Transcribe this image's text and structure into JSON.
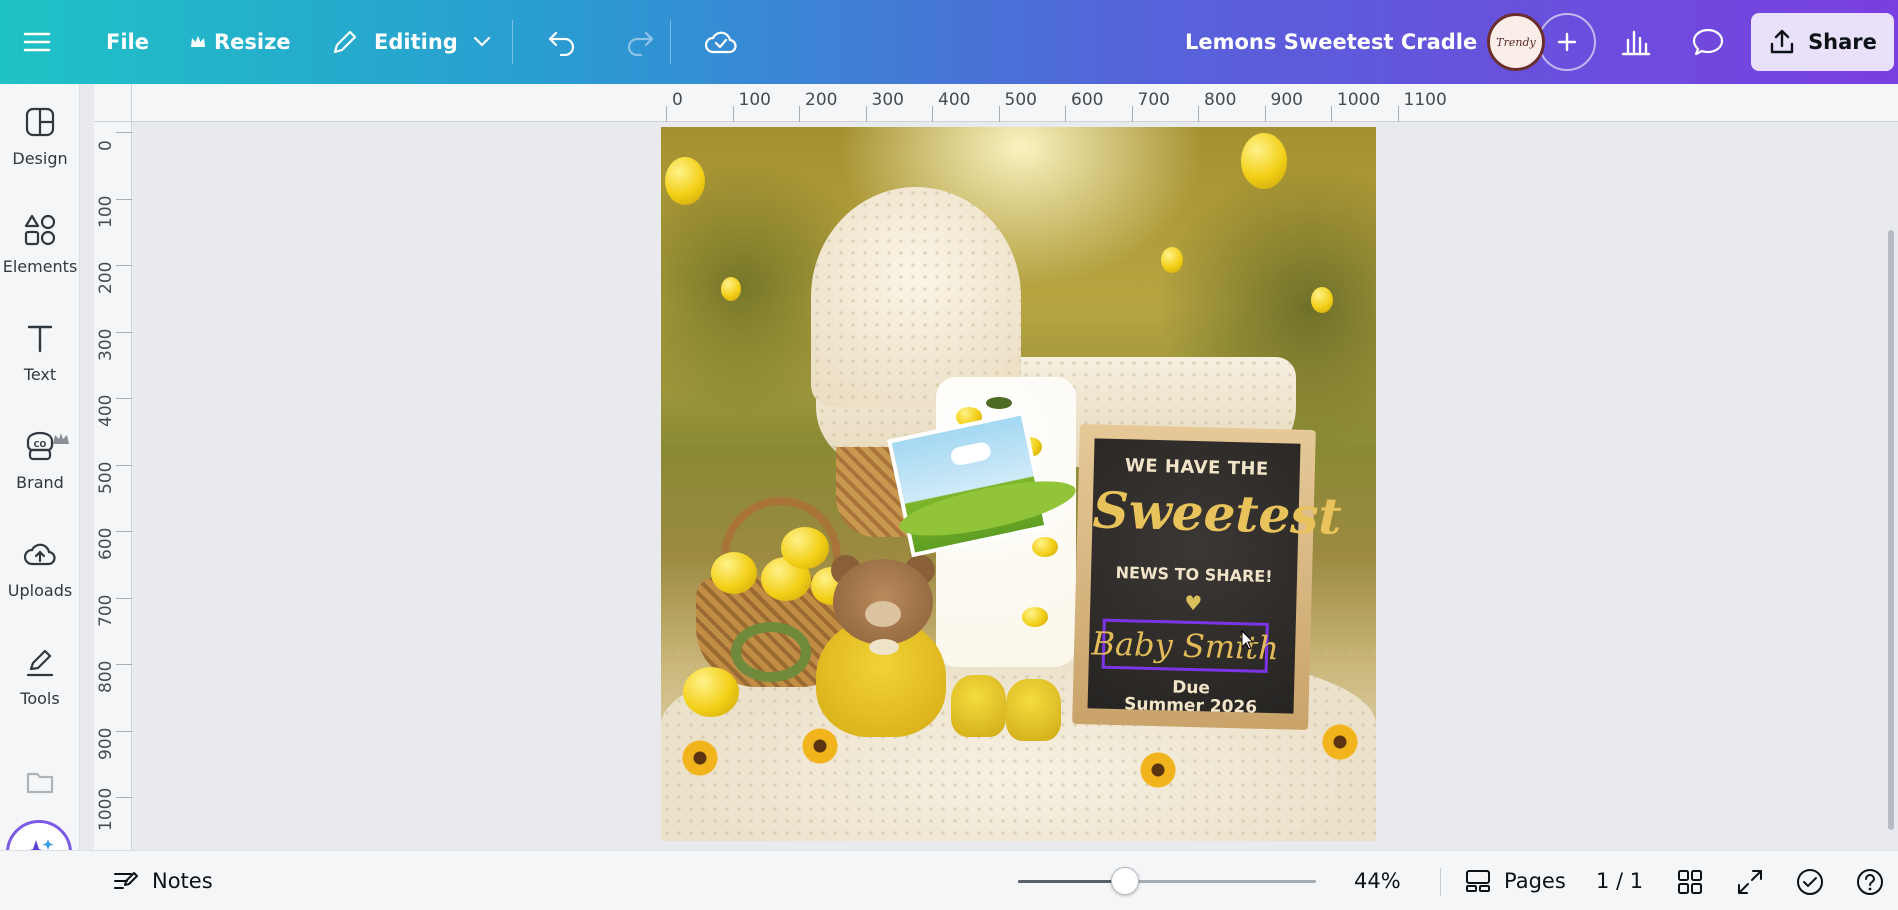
{
  "topbar": {
    "file_label": "File",
    "resize_label": "Resize",
    "editing_label": "Editing",
    "doc_title": "Lemons Sweetest Cradle",
    "share_label": "Share",
    "avatar_text": "Trendy"
  },
  "sidebar": {
    "items": [
      {
        "label": "Design",
        "icon": "design-icon"
      },
      {
        "label": "Elements",
        "icon": "elements-icon"
      },
      {
        "label": "Text",
        "icon": "text-icon"
      },
      {
        "label": "Brand",
        "icon": "brand-icon"
      },
      {
        "label": "Uploads",
        "icon": "uploads-icon"
      },
      {
        "label": "Tools",
        "icon": "tools-icon"
      }
    ]
  },
  "ruler": {
    "top": [
      "0",
      "100",
      "200",
      "300",
      "400",
      "500",
      "600",
      "700",
      "800",
      "900",
      "1000",
      "1100"
    ],
    "left": [
      "0",
      "100",
      "200",
      "300",
      "400",
      "500",
      "600",
      "700",
      "800",
      "900",
      "1000"
    ]
  },
  "design": {
    "line1": "WE HAVE THE",
    "headline": "Sweetest",
    "line2": "NEWS TO SHARE!",
    "heart": "♥",
    "name": "Baby Smith",
    "due_line1": "Due",
    "due_line2": "Summer 2026"
  },
  "bottombar": {
    "notes_label": "Notes",
    "zoom": "44%",
    "zoom_level": 0.44,
    "pages_label": "Pages",
    "page_count": "1 / 1"
  },
  "colors": {
    "accent": "#7b35e6",
    "share_bg": "#e9e0fb",
    "gradient_start": "#1fc2c5",
    "gradient_end": "#7a3fe0"
  }
}
